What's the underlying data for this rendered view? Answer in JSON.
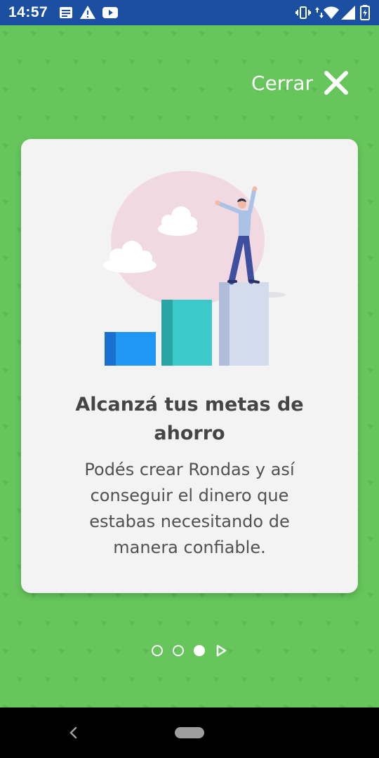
{
  "status_bar": {
    "time": "14:57",
    "left_icons": [
      "notes-icon",
      "warning-icon",
      "youtube-icon"
    ],
    "right_icons": [
      "vibrate-icon",
      "data-arrows-icon",
      "wifi-icon",
      "signal-icon",
      "battery-charging-icon"
    ]
  },
  "header": {
    "close_label": "Cerrar"
  },
  "slide": {
    "title": "Alcanzá tus metas de ahorro",
    "body": "Podés crear Rondas y así conseguir el dinero que estabas necesitando de manera confiable."
  },
  "pager": {
    "total": 3,
    "current": 3
  },
  "colors": {
    "background": "#66c65c",
    "status_bar": "#1a4fa1",
    "card": "#f3f3f4",
    "bar_blue": "#2196f3",
    "bar_teal": "#3cc9cc",
    "bar_lavender": "#d3dcec"
  }
}
